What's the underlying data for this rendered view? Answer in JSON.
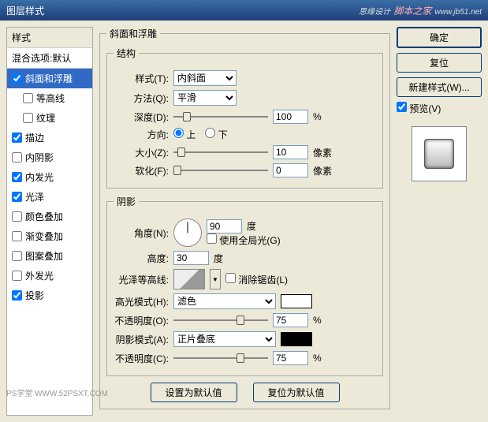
{
  "title": "图层样式",
  "watermark": {
    "brand": "思缘设计",
    "main": "脚本之家",
    "url": "www.jb51.net"
  },
  "styles_panel": {
    "header": "样式",
    "blend": "混合选项:默认",
    "items": [
      {
        "label": "斜面和浮雕",
        "checked": true,
        "selected": true
      },
      {
        "label": "等高线",
        "checked": false,
        "indent": true
      },
      {
        "label": "纹理",
        "checked": false,
        "indent": true
      },
      {
        "label": "描边",
        "checked": true
      },
      {
        "label": "内阴影",
        "checked": false
      },
      {
        "label": "内发光",
        "checked": true
      },
      {
        "label": "光泽",
        "checked": true
      },
      {
        "label": "颜色叠加",
        "checked": false
      },
      {
        "label": "渐变叠加",
        "checked": false
      },
      {
        "label": "图案叠加",
        "checked": false
      },
      {
        "label": "外发光",
        "checked": false
      },
      {
        "label": "投影",
        "checked": true
      }
    ]
  },
  "bevel": {
    "group_title": "斜面和浮雕",
    "structure_title": "结构",
    "style_label": "样式(T):",
    "style_value": "内斜面",
    "technique_label": "方法(Q):",
    "technique_value": "平滑",
    "depth_label": "深度(D):",
    "depth_value": "100",
    "depth_unit": "%",
    "direction_label": "方向:",
    "dir_up": "上",
    "dir_down": "下",
    "size_label": "大小(Z):",
    "size_value": "10",
    "size_unit": "像素",
    "soften_label": "软化(F):",
    "soften_value": "0",
    "soften_unit": "像素"
  },
  "shading": {
    "title": "阴影",
    "angle_label": "角度(N):",
    "angle_value": "90",
    "angle_unit": "度",
    "global_light": "使用全局光(G)",
    "altitude_label": "高度:",
    "altitude_value": "30",
    "altitude_unit": "度",
    "gloss_label": "光泽等高线:",
    "anti_alias": "消除锯齿(L)",
    "highlight_mode_label": "高光模式(H):",
    "highlight_mode": "滤色",
    "highlight_opacity_label": "不透明度(O):",
    "highlight_opacity": "75",
    "opacity_unit": "%",
    "shadow_mode_label": "阴影模式(A):",
    "shadow_mode": "正片叠底",
    "shadow_opacity_label": "不透明度(C):",
    "shadow_opacity": "75"
  },
  "buttons": {
    "ok": "确定",
    "cancel": "复位",
    "new_style": "新建样式(W)...",
    "preview": "预览(V)",
    "make_default": "设置为默认值",
    "reset_default": "复位为默认值"
  },
  "footer": "PS学堂  WWW.52PSXT.COM"
}
